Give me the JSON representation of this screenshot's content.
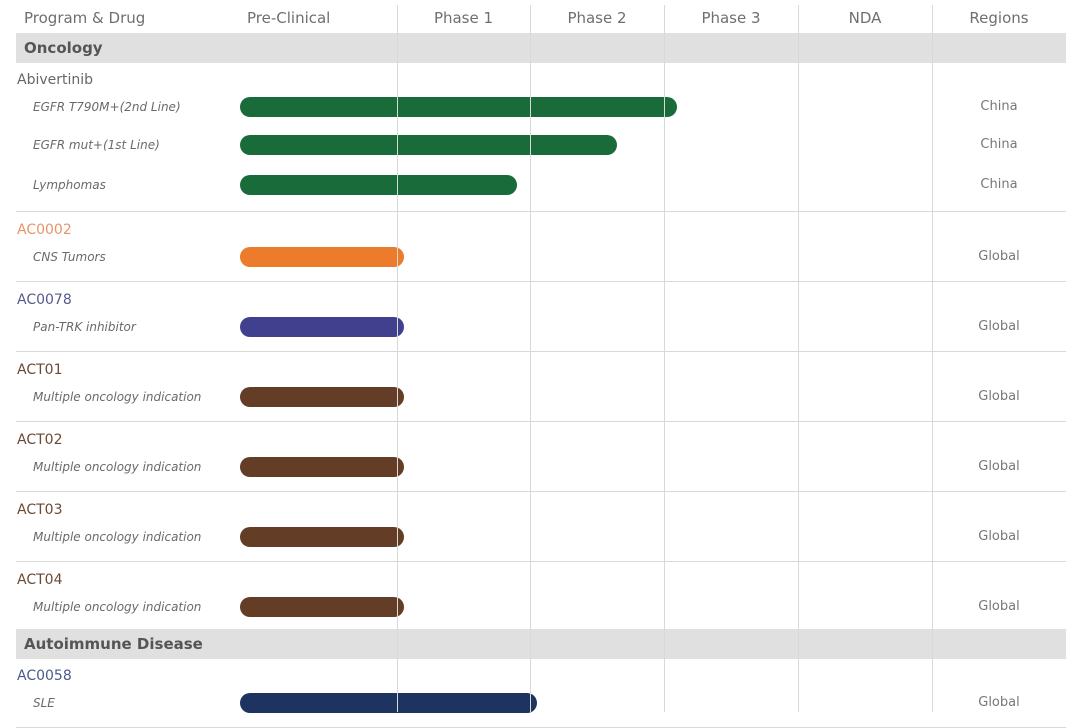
{
  "headers": {
    "program": "Program & Drug",
    "preclinical": "Pre-Clinical",
    "phase1": "Phase 1",
    "phase2": "Phase 2",
    "phase3": "Phase 3",
    "nda": "NDA",
    "regions": "Regions"
  },
  "chart_data": {
    "type": "bar",
    "orientation": "horizontal",
    "stages": [
      "Pre-Clinical",
      "Phase 1",
      "Phase 2",
      "Phase 3",
      "NDA"
    ],
    "progress_unit": "stage index (0 = start of Pre-Clinical, 1 = end of Pre-Clinical, 2 = end of Phase 1, ...)",
    "sections": [
      {
        "name": "Oncology",
        "programs": [
          {
            "drug": "Abivertinib",
            "color": "#676767",
            "indications": [
              {
                "name": "EGFR T790M+(2nd Line)",
                "progress": 3.1,
                "region": "China",
                "bar_color": "#1a6b3a"
              },
              {
                "name": "EGFR mut+(1st Line)",
                "progress": 2.65,
                "region": "China",
                "bar_color": "#1a6b3a"
              },
              {
                "name": "Lymphomas",
                "progress": 1.9,
                "region": "China",
                "bar_color": "#1a6b3a"
              }
            ]
          },
          {
            "drug": "AC0002",
            "color": "#e8946a",
            "indications": [
              {
                "name": "CNS Tumors",
                "progress": 1.05,
                "region": "Global",
                "bar_color": "#ec7b2b"
              }
            ]
          },
          {
            "drug": "AC0078",
            "color": "#575a8a",
            "indications": [
              {
                "name": "Pan-TRK inhibitor",
                "progress": 1.05,
                "region": "Global",
                "bar_color": "#40408f"
              }
            ]
          },
          {
            "drug": "ACT01",
            "color": "#6b4a33",
            "indications": [
              {
                "name": "Multiple oncology indication",
                "progress": 1.05,
                "region": "Global",
                "bar_color": "#633d25"
              }
            ]
          },
          {
            "drug": "ACT02",
            "color": "#6b4a33",
            "indications": [
              {
                "name": "Multiple oncology indication",
                "progress": 1.05,
                "region": "Global",
                "bar_color": "#633d25"
              }
            ]
          },
          {
            "drug": "ACT03",
            "color": "#6b4a33",
            "indications": [
              {
                "name": "Multiple oncology indication",
                "progress": 1.05,
                "region": "Global",
                "bar_color": "#633d25"
              }
            ]
          },
          {
            "drug": "ACT04",
            "color": "#6b4a33",
            "indications": [
              {
                "name": "Multiple oncology indication",
                "progress": 1.05,
                "region": "Global",
                "bar_color": "#633d25"
              }
            ]
          }
        ]
      },
      {
        "name": "Autoimmune Disease",
        "programs": [
          {
            "drug": "AC0058",
            "color": "#4a5a8a",
            "indications": [
              {
                "name": "SLE",
                "progress": 2.05,
                "region": "Global",
                "bar_color": "#1d3461"
              }
            ]
          }
        ]
      }
    ]
  }
}
